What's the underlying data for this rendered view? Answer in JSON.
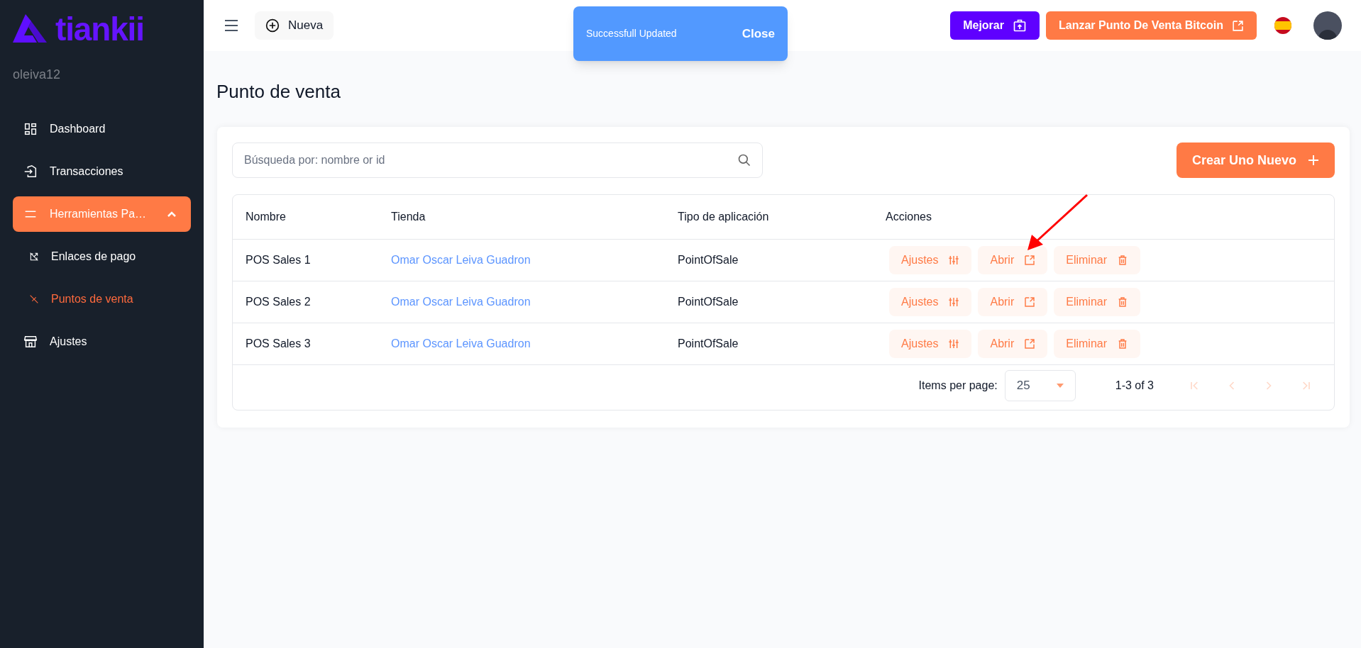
{
  "sidebar": {
    "logo": "tiankii",
    "username": "oleiva12",
    "items": [
      {
        "label": "Dashboard",
        "selected": false
      },
      {
        "label": "Transacciones",
        "selected": false
      },
      {
        "label": "Herramientas Pa…",
        "selected": true,
        "expanded": true,
        "children": [
          {
            "label": "Enlaces de pago",
            "selected": false
          },
          {
            "label": "Puntos de venta",
            "selected": true
          }
        ]
      },
      {
        "label": "Ajustes",
        "selected": false
      }
    ]
  },
  "topbar": {
    "new_button": "Nueva",
    "upgrade_button": "Mejorar",
    "launch_button": "Lanzar Punto De Venta Bitcoin"
  },
  "toast": {
    "message": "Successfull Updated",
    "action": "Close"
  },
  "page": {
    "title": "Punto de venta",
    "search": {
      "placeholder": "Búsqueda por: nombre or id"
    },
    "create_button": "Crear Uno Nuevo"
  },
  "table": {
    "columns": [
      "Nombre",
      "Tienda",
      "Tipo de aplicación",
      "Acciones"
    ],
    "rows": [
      {
        "name": "POS Sales 1",
        "store": "Omar Oscar Leiva Guadron",
        "type": "PointOfSale",
        "actions": [
          "Ajustes",
          "Abrir",
          "Eliminar"
        ]
      },
      {
        "name": "POS Sales 2",
        "store": "Omar Oscar Leiva Guadron",
        "type": "PointOfSale",
        "actions": [
          "Ajustes",
          "Abrir",
          "Eliminar"
        ]
      },
      {
        "name": "POS Sales 3",
        "store": "Omar Oscar Leiva Guadron",
        "type": "PointOfSale",
        "actions": [
          "Ajustes",
          "Abrir",
          "Eliminar"
        ]
      }
    ]
  },
  "pagination": {
    "label": "Items per page:",
    "page_size": "25",
    "range": "1-3 of 3",
    "buttons": [
      {
        "kind": "first",
        "disabled": true
      },
      {
        "kind": "prev",
        "disabled": true
      },
      {
        "kind": "next",
        "disabled": true
      },
      {
        "kind": "last",
        "disabled": true
      }
    ]
  }
}
